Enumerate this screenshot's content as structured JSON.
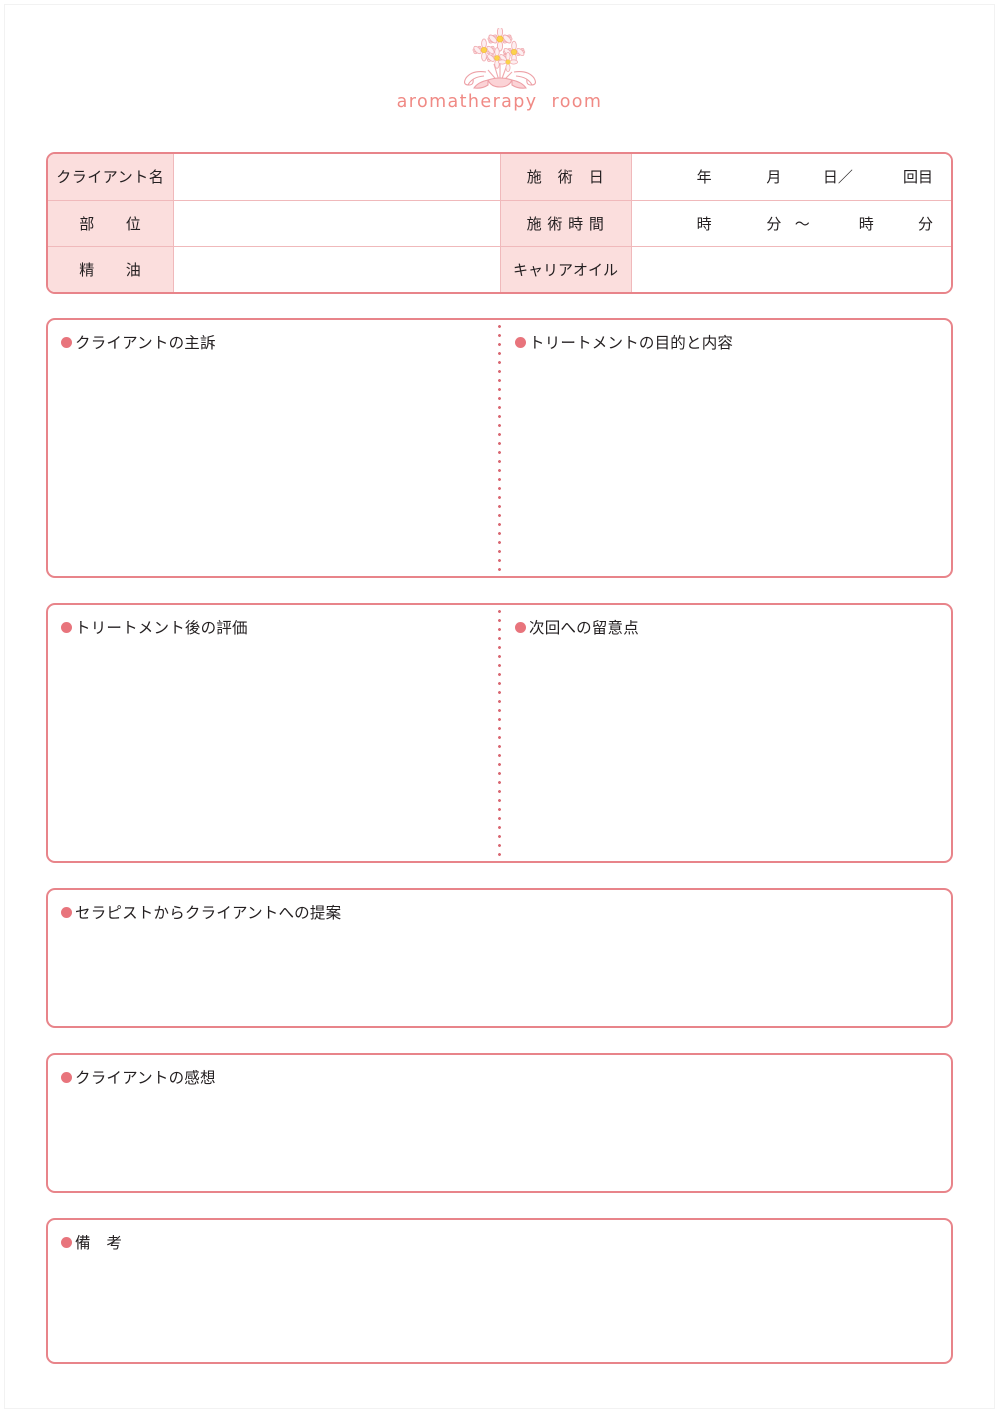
{
  "header": {
    "logo_icon": "flower-bouquet-icon",
    "brand_text": "aromatherapy  room",
    "brand_color": "#f08a85"
  },
  "theme": {
    "border_color": "#e8848a",
    "label_fill": "#fbdedd",
    "bullet_color": "#e8747c",
    "inner_rule_color": "#f0b9bb"
  },
  "info_table": {
    "rows": [
      {
        "left_label": "クライアント名",
        "left_value": "",
        "right_label": "施　術　日",
        "right_value": {
          "year": "年",
          "month": "月",
          "day": "日／",
          "count": "回目"
        }
      },
      {
        "left_label": "部　　位",
        "left_value": "",
        "right_label": "施 術 時 間",
        "right_value": {
          "start_hour": "時",
          "start_minute": "分",
          "separator": "〜",
          "end_hour": "時",
          "end_minute": "分"
        }
      },
      {
        "left_label": "精　　油",
        "left_value": "",
        "right_label": "キャリアオイル",
        "right_value": ""
      }
    ]
  },
  "sections": [
    {
      "id": "complaint",
      "left_title": "クライアントの主訴",
      "left_body": "",
      "right_title": "トリートメントの目的と内容",
      "right_body": "",
      "split": true
    },
    {
      "id": "evaluation",
      "left_title": "トリートメント後の評価",
      "left_body": "",
      "right_title": "次回への留意点",
      "right_body": "",
      "split": true
    },
    {
      "id": "proposal",
      "left_title": "セラピストからクライアントへの提案",
      "left_body": "",
      "split": false
    },
    {
      "id": "impression",
      "left_title": "クライアントの感想",
      "left_body": "",
      "split": false
    },
    {
      "id": "remarks",
      "left_title": "備　考",
      "left_body": "",
      "split": false
    }
  ]
}
